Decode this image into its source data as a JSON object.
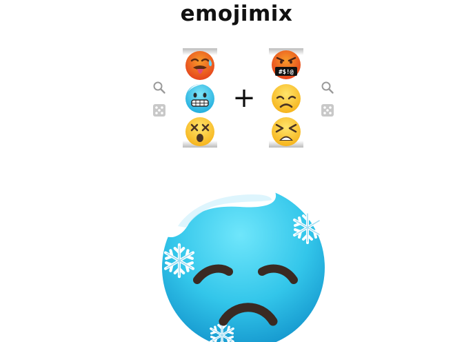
{
  "app": {
    "title": "emojimix",
    "plus": "+"
  },
  "left_column": {
    "items": [
      "hot-face",
      "cold-face",
      "face-with-crossed-out-eyes"
    ],
    "selected": "cold-face"
  },
  "right_column": {
    "items": [
      "face-with-symbols-on-mouth",
      "disappointed-face",
      "tired-face"
    ],
    "selected": "disappointed-face"
  },
  "tools": [
    "search-icon",
    "dice-icon"
  ],
  "result": "cold-disappointed-face-mix",
  "colors": {
    "ice_blue": "#29c6ea",
    "emoji_yellow": "#fcc21b",
    "angry_red": "#e8461e",
    "tool_gray": "#c8c8c8"
  }
}
